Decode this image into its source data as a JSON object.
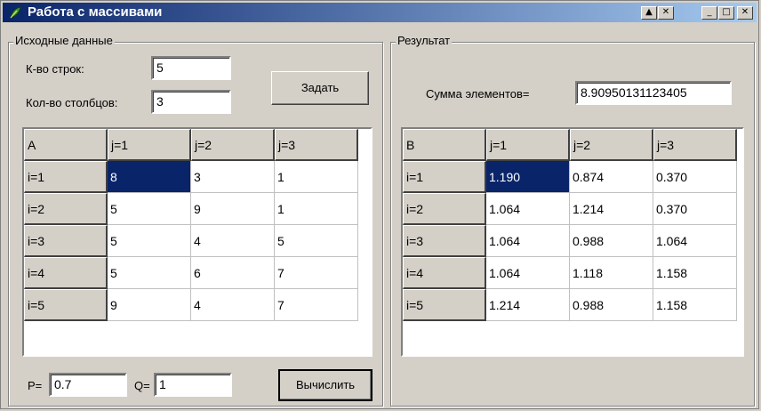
{
  "window": {
    "title": "Работа с массивами",
    "buttons": {
      "help": "▲",
      "context": "✕",
      "minimize": "_",
      "maximize": "□",
      "close": "✕"
    }
  },
  "source": {
    "group_label": "Исходные данные",
    "rows_label": "К-во строк:",
    "rows_value": "5",
    "cols_label": "Кол-во столбцов:",
    "cols_value": "3",
    "set_button": "Задать",
    "table": {
      "corner": "A",
      "col_headers": [
        "j=1",
        "j=2",
        "j=3"
      ],
      "row_headers": [
        "i=1",
        "i=2",
        "i=3",
        "i=4",
        "i=5"
      ],
      "rows": [
        [
          "8",
          "3",
          "1"
        ],
        [
          "5",
          "9",
          "1"
        ],
        [
          "5",
          "4",
          "5"
        ],
        [
          "5",
          "6",
          "7"
        ],
        [
          "9",
          "4",
          "7"
        ]
      ]
    },
    "p_label": "P=",
    "p_value": "0.7",
    "q_label": "Q=",
    "q_value": "1",
    "calc_button": "Вычислить"
  },
  "result": {
    "group_label": "Результат",
    "sum_label": "Сумма элементов=",
    "sum_value": "8.90950131123405",
    "table": {
      "corner": "B",
      "col_headers": [
        "j=1",
        "j=2",
        "j=3"
      ],
      "row_headers": [
        "i=1",
        "i=2",
        "i=3",
        "i=4",
        "i=5"
      ],
      "rows": [
        [
          "1.190",
          "0.874",
          "0.370"
        ],
        [
          "1.064",
          "1.214",
          "0.370"
        ],
        [
          "1.064",
          "0.988",
          "1.064"
        ],
        [
          "1.064",
          "1.118",
          "1.158"
        ],
        [
          "1.214",
          "0.988",
          "1.158"
        ]
      ]
    }
  },
  "colors": {
    "title_start": "#0a246a",
    "title_end": "#a6caf0",
    "selection": "#0a246a",
    "face": "#d4d0c8"
  }
}
